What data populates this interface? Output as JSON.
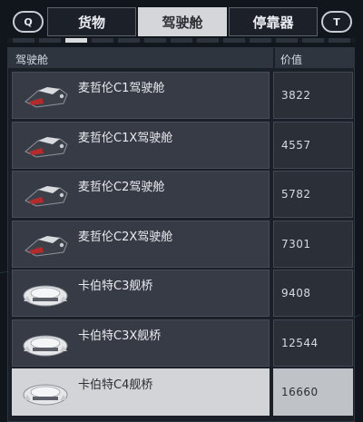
{
  "keys": {
    "left": "Q",
    "right": "T"
  },
  "tabs": [
    {
      "label": "货物",
      "active": false
    },
    {
      "label": "驾驶舱",
      "active": true
    },
    {
      "label": "停靠器",
      "active": false
    }
  ],
  "indicator": {
    "segments": 13,
    "active_index": 2
  },
  "table": {
    "columns": {
      "name": "驾驶舱",
      "price": "价值"
    },
    "rows": [
      {
        "name": "麦哲伦C1驾驶舱",
        "price": "3822",
        "icon": "cockpit-c1-icon",
        "selected": false
      },
      {
        "name": "麦哲伦C1X驾驶舱",
        "price": "4557",
        "icon": "cockpit-c1x-icon",
        "selected": false
      },
      {
        "name": "麦哲伦C2驾驶舱",
        "price": "5782",
        "icon": "cockpit-c2-icon",
        "selected": false
      },
      {
        "name": "麦哲伦C2X驾驶舱",
        "price": "7301",
        "icon": "cockpit-c2x-icon",
        "selected": false
      },
      {
        "name": "卡伯特C3舰桥",
        "price": "9408",
        "icon": "bridge-c3-icon",
        "selected": false
      },
      {
        "name": "卡伯特C3X舰桥",
        "price": "12544",
        "icon": "bridge-c3x-icon",
        "selected": false
      },
      {
        "name": "卡伯特C4舰桥",
        "price": "16660",
        "icon": "bridge-c4-icon",
        "selected": true
      }
    ]
  },
  "colors": {
    "accent_selected": "#d2d4d7",
    "row_bg": "#363b45",
    "panel_bg": "#1b2028"
  }
}
